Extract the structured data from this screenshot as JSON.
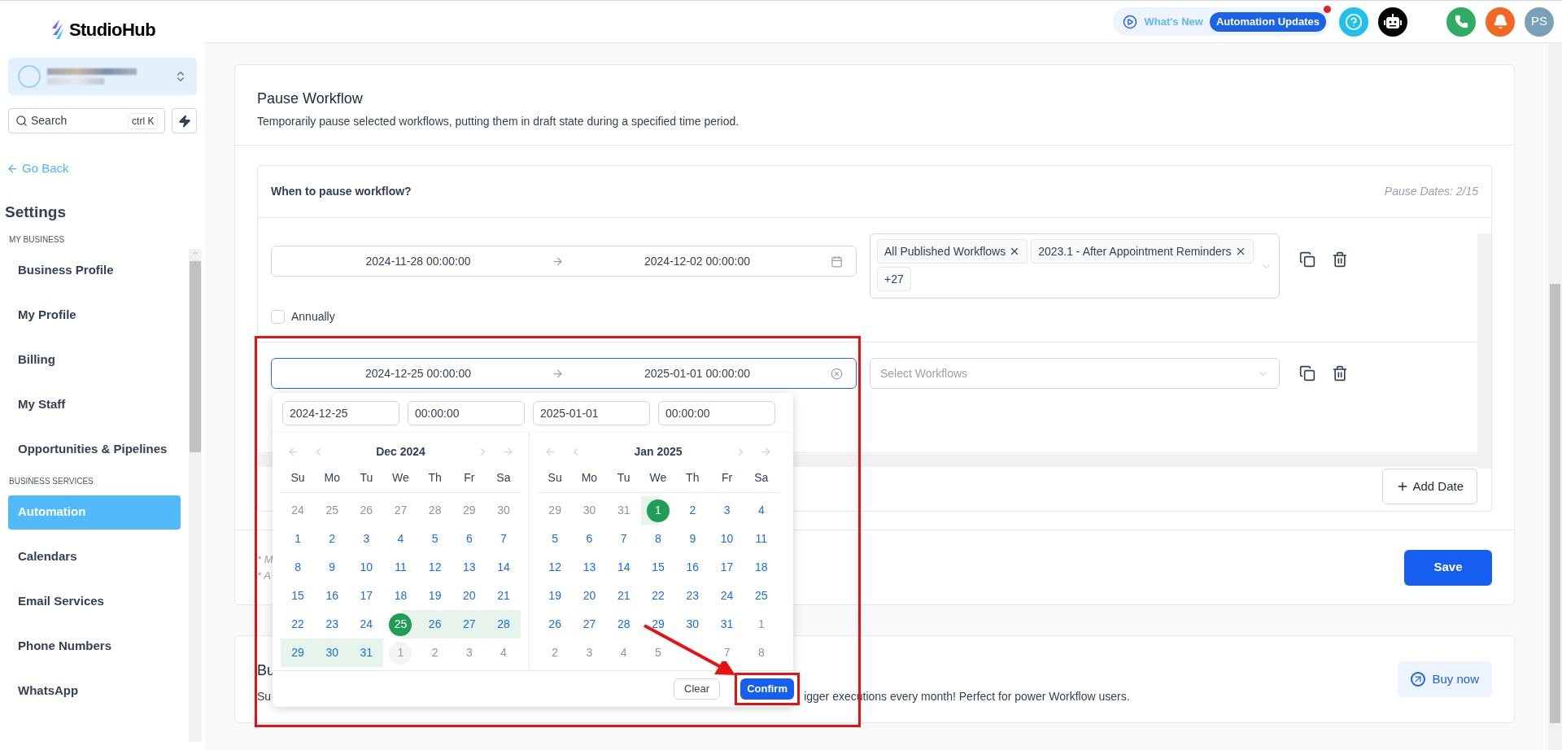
{
  "sidebar": {
    "logo": "StudioHub",
    "search": {
      "placeholder": "Search",
      "shortcut": "ctrl K"
    },
    "back": "Go Back",
    "title": "Settings",
    "sections": [
      {
        "heading": "MY BUSINESS",
        "items": [
          {
            "label": "Business Profile",
            "selected": false
          },
          {
            "label": "My Profile",
            "selected": false
          },
          {
            "label": "Billing",
            "selected": false
          },
          {
            "label": "My Staff",
            "selected": false
          },
          {
            "label": "Opportunities & Pipelines",
            "selected": false
          }
        ]
      },
      {
        "heading": "BUSINESS SERVICES",
        "items": [
          {
            "label": "Automation",
            "selected": true
          },
          {
            "label": "Calendars",
            "selected": false
          },
          {
            "label": "Email Services",
            "selected": false
          },
          {
            "label": "Phone Numbers",
            "selected": false
          },
          {
            "label": "WhatsApp",
            "selected": false
          }
        ]
      }
    ]
  },
  "topbar": {
    "whats_new": "What's New",
    "updates": "Automation Updates",
    "avatar": "PS"
  },
  "pause_card": {
    "title": "Pause Workflow",
    "description": "Temporarily pause selected workflows, putting them in draft state during a specified time period.",
    "section_title": "When to pause workflow?",
    "counter": "Pause Dates: 2/15",
    "rows": [
      {
        "start": "2024-11-28 00:00:00",
        "end": "2024-12-02 00:00:00",
        "active": false,
        "tags": [
          {
            "label": "All Published Workflows",
            "removable": true
          },
          {
            "label": "2023.1 - After Appointment Reminders",
            "removable": true
          },
          {
            "label": "+27",
            "removable": false
          }
        ],
        "annually": {
          "label": "Annually",
          "checked": false
        }
      },
      {
        "start": "2024-12-25 00:00:00",
        "end": "2025-01-01 00:00:00",
        "active": true,
        "placeholder": "Select Workflows"
      }
    ],
    "add_date": "Add Date",
    "notes": [
      "* M",
      "* A"
    ],
    "save": "Save"
  },
  "picker": {
    "inputs": [
      "2024-12-25",
      "00:00:00",
      "2025-01-01",
      "00:00:00"
    ],
    "months": [
      {
        "title": "Dec 2024",
        "weekdays": [
          "Su",
          "Mo",
          "Tu",
          "We",
          "Th",
          "Fr",
          "Sa"
        ],
        "weeks": [
          [
            {
              "label": "24",
              "kind": "muted"
            },
            {
              "label": "25",
              "kind": "muted"
            },
            {
              "label": "26",
              "kind": "muted"
            },
            {
              "label": "27",
              "kind": "muted"
            },
            {
              "label": "28",
              "kind": "muted"
            },
            {
              "label": "29",
              "kind": "muted"
            },
            {
              "label": "30",
              "kind": "muted"
            }
          ],
          [
            {
              "label": "1",
              "kind": "normal"
            },
            {
              "label": "2",
              "kind": "normal"
            },
            {
              "label": "3",
              "kind": "normal"
            },
            {
              "label": "4",
              "kind": "normal"
            },
            {
              "label": "5",
              "kind": "normal"
            },
            {
              "label": "6",
              "kind": "normal"
            },
            {
              "label": "7",
              "kind": "normal"
            }
          ],
          [
            {
              "label": "8",
              "kind": "normal"
            },
            {
              "label": "9",
              "kind": "normal"
            },
            {
              "label": "10",
              "kind": "normal"
            },
            {
              "label": "11",
              "kind": "normal"
            },
            {
              "label": "12",
              "kind": "normal"
            },
            {
              "label": "13",
              "kind": "normal"
            },
            {
              "label": "14",
              "kind": "normal"
            }
          ],
          [
            {
              "label": "15",
              "kind": "normal"
            },
            {
              "label": "16",
              "kind": "normal"
            },
            {
              "label": "17",
              "kind": "normal"
            },
            {
              "label": "18",
              "kind": "normal"
            },
            {
              "label": "19",
              "kind": "normal"
            },
            {
              "label": "20",
              "kind": "normal"
            },
            {
              "label": "21",
              "kind": "normal"
            }
          ],
          [
            {
              "label": "22",
              "kind": "normal"
            },
            {
              "label": "23",
              "kind": "normal"
            },
            {
              "label": "24",
              "kind": "normal"
            },
            {
              "label": "25",
              "kind": "start"
            },
            {
              "label": "26",
              "kind": "range"
            },
            {
              "label": "27",
              "kind": "range"
            },
            {
              "label": "28",
              "kind": "range"
            }
          ],
          [
            {
              "label": "29",
              "kind": "range"
            },
            {
              "label": "30",
              "kind": "range"
            },
            {
              "label": "31",
              "kind": "range"
            },
            {
              "label": "1",
              "kind": "marked"
            },
            {
              "label": "2",
              "kind": "muted"
            },
            {
              "label": "3",
              "kind": "muted"
            },
            {
              "label": "4",
              "kind": "muted"
            }
          ]
        ]
      },
      {
        "title": "Jan 2025",
        "weekdays": [
          "Su",
          "Mo",
          "Tu",
          "We",
          "Th",
          "Fr",
          "Sa"
        ],
        "weeks": [
          [
            {
              "label": "29",
              "kind": "muted"
            },
            {
              "label": "30",
              "kind": "muted"
            },
            {
              "label": "31",
              "kind": "muted"
            },
            {
              "label": "1",
              "kind": "end"
            },
            {
              "label": "2",
              "kind": "normal"
            },
            {
              "label": "3",
              "kind": "normal"
            },
            {
              "label": "4",
              "kind": "normal"
            }
          ],
          [
            {
              "label": "5",
              "kind": "normal"
            },
            {
              "label": "6",
              "kind": "normal"
            },
            {
              "label": "7",
              "kind": "normal"
            },
            {
              "label": "8",
              "kind": "normal"
            },
            {
              "label": "9",
              "kind": "normal"
            },
            {
              "label": "10",
              "kind": "normal"
            },
            {
              "label": "11",
              "kind": "normal"
            }
          ],
          [
            {
              "label": "12",
              "kind": "normal"
            },
            {
              "label": "13",
              "kind": "normal"
            },
            {
              "label": "14",
              "kind": "normal"
            },
            {
              "label": "15",
              "kind": "normal"
            },
            {
              "label": "16",
              "kind": "normal"
            },
            {
              "label": "17",
              "kind": "normal"
            },
            {
              "label": "18",
              "kind": "normal"
            }
          ],
          [
            {
              "label": "19",
              "kind": "normal"
            },
            {
              "label": "20",
              "kind": "normal"
            },
            {
              "label": "21",
              "kind": "normal"
            },
            {
              "label": "22",
              "kind": "normal"
            },
            {
              "label": "23",
              "kind": "normal"
            },
            {
              "label": "24",
              "kind": "normal"
            },
            {
              "label": "25",
              "kind": "normal"
            }
          ],
          [
            {
              "label": "26",
              "kind": "normal"
            },
            {
              "label": "27",
              "kind": "normal"
            },
            {
              "label": "28",
              "kind": "normal"
            },
            {
              "label": "29",
              "kind": "normal"
            },
            {
              "label": "30",
              "kind": "normal"
            },
            {
              "label": "31",
              "kind": "normal"
            },
            {
              "label": "1",
              "kind": "muted"
            }
          ],
          [
            {
              "label": "2",
              "kind": "muted"
            },
            {
              "label": "3",
              "kind": "muted"
            },
            {
              "label": "4",
              "kind": "muted"
            },
            {
              "label": "5",
              "kind": "muted"
            },
            {
              "kind": "covered"
            },
            {
              "label": "7",
              "kind": "muted"
            },
            {
              "label": "8",
              "kind": "muted"
            }
          ]
        ]
      }
    ],
    "clear": "Clear",
    "confirm": "Confirm"
  },
  "buy_card": {
    "title": "Bu",
    "text_start": "Su",
    "text_end": "igger executions every month! Perfect for power Workflow users.",
    "button": "Buy now"
  }
}
